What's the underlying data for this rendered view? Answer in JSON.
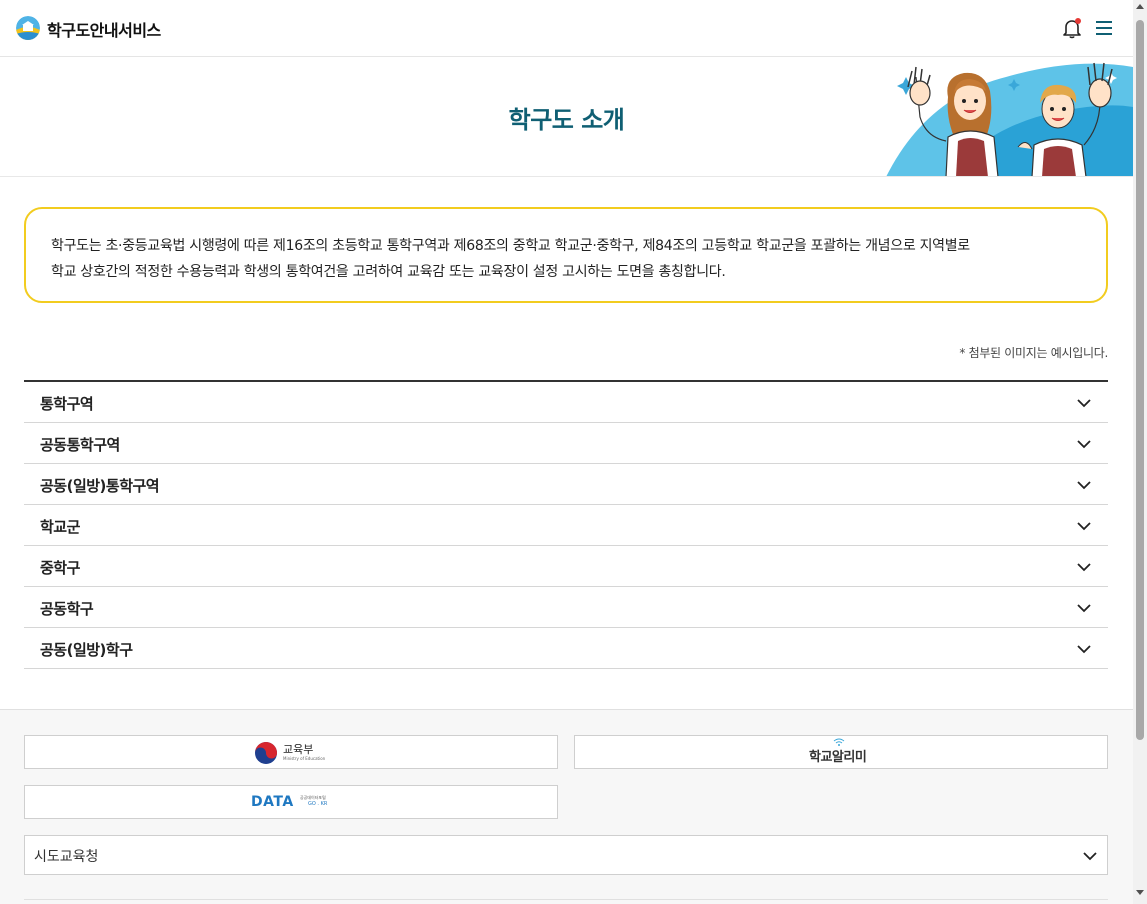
{
  "header": {
    "site_title": "학구도안내서비스",
    "bell_icon": "bell-icon",
    "menu_icon": "hamburger-menu-icon",
    "accent_color": "#0f5f73",
    "notification_dot_color": "#e53935"
  },
  "banner": {
    "title": "학구도 소개"
  },
  "intro": {
    "text_line1": "학구도는 초·중등교육법 시행령에 따른 제16조의 초등학교 통학구역과 제68조의 중학교 학교군·중학구, 제84조의 고등학교 학교군을 포괄하는 개념으로 지역별로",
    "text_line2": "학교 상호간의 적정한 수용능력과 학생의 통학여건을 고려하여 교육감 또는 교육장이 설정 고시하는 도면을 총칭합니다.",
    "border_color": "#f2cc1f"
  },
  "note": "* 첨부된 이미지는 예시입니다.",
  "accordion": [
    {
      "label": "통학구역"
    },
    {
      "label": "공동통학구역"
    },
    {
      "label": "공동(일방)통학구역"
    },
    {
      "label": "학교군"
    },
    {
      "label": "중학구"
    },
    {
      "label": "공동학구"
    },
    {
      "label": "공동(일방)학구"
    }
  ],
  "footer": {
    "links": {
      "moe_label": "교육부",
      "moe_sub": "Ministry of Education",
      "school_info_label": "학교알리미",
      "data_label": "DATA",
      "data_sub1": "공공데이터포털",
      "data_sub2": "GO . KR"
    },
    "select_label": "시도교육청"
  }
}
